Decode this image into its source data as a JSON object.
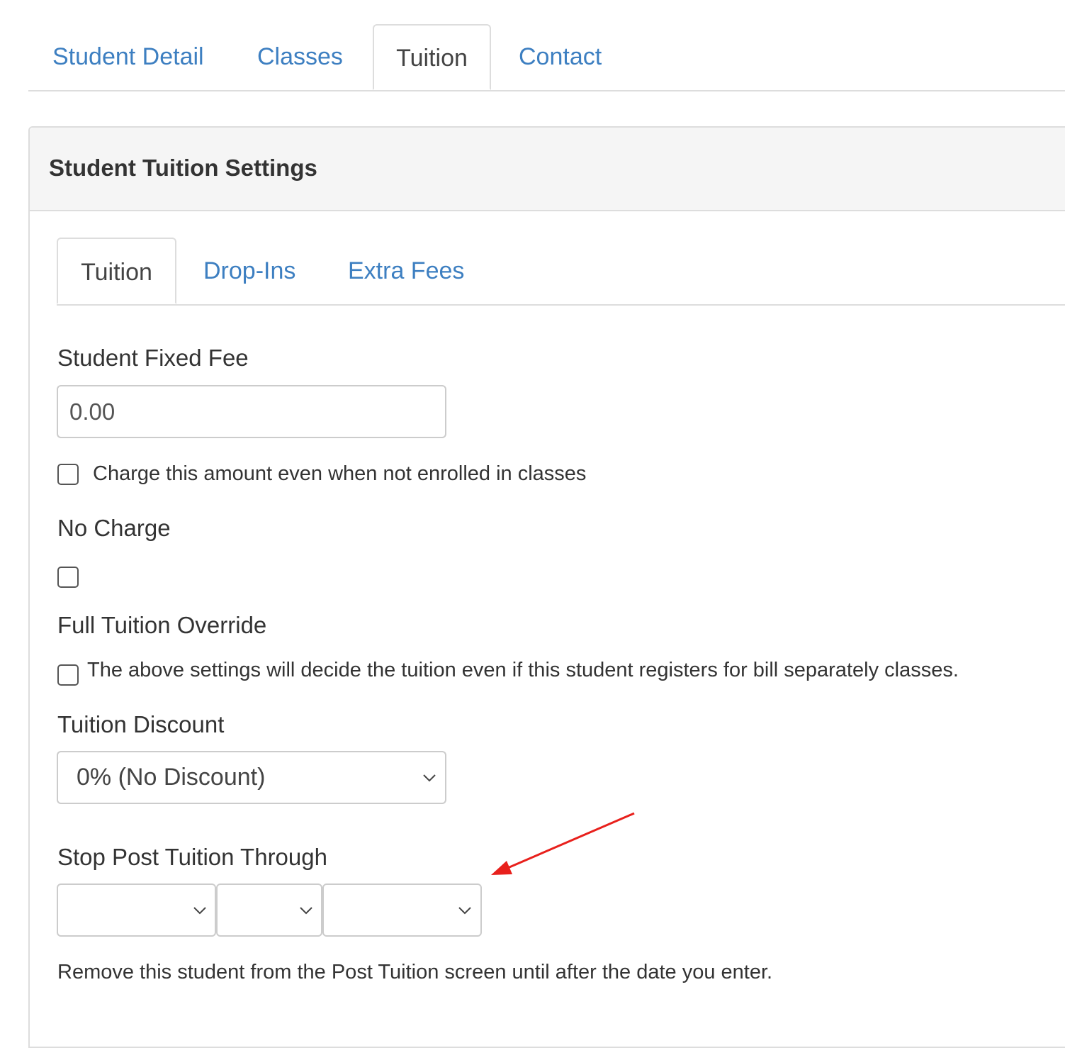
{
  "top_tabs": {
    "student_detail": "Student Detail",
    "classes": "Classes",
    "tuition": "Tuition",
    "contact": "Contact"
  },
  "panel": {
    "title": "Student Tuition Settings"
  },
  "inner_tabs": {
    "tuition": "Tuition",
    "drop_ins": "Drop-Ins",
    "extra_fees": "Extra Fees"
  },
  "fixed_fee": {
    "label": "Student Fixed Fee",
    "value": "0.00",
    "charge_checkbox_label": "Charge this amount even when not enrolled in classes"
  },
  "no_charge": {
    "label": "No Charge"
  },
  "full_override": {
    "label": "Full Tuition Override",
    "checkbox_label": "The above settings will decide the tuition even if this student registers for bill separately classes."
  },
  "discount": {
    "label": "Tuition Discount",
    "selected": "0% (No Discount)"
  },
  "stop_post": {
    "label": "Stop Post Tuition Through",
    "month": "",
    "day": "",
    "year": "",
    "help": "Remove this student from the Post Tuition screen until after the date you enter."
  },
  "annotation": {
    "arrow_color": "#e8201c"
  }
}
